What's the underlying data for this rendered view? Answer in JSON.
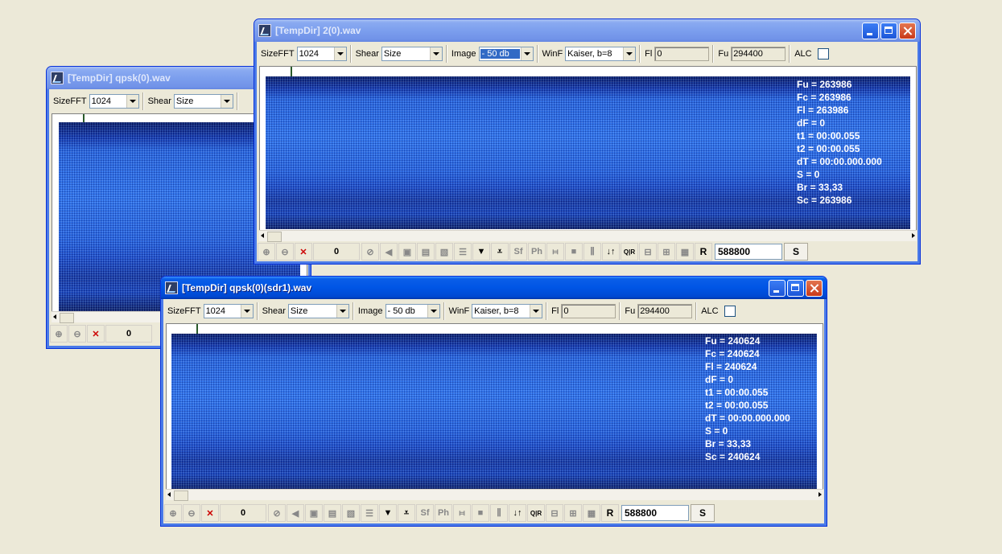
{
  "windows": {
    "back": {
      "title": "[TempDir] qpsk(0).wav",
      "sizefft_label": "SizeFFT",
      "sizefft_value": "1024",
      "shear_label": "Shear",
      "shear_value": "Size",
      "counter": "0"
    },
    "top": {
      "title": "[TempDir] 2(0).wav",
      "sizefft_label": "SizeFFT",
      "sizefft_value": "1024",
      "shear_label": "Shear",
      "shear_value": "Size",
      "image_label": "Image",
      "image_value": "- 50 db",
      "winf_label": "WinF",
      "winf_value": "Kaiser, b=8",
      "fl_label": "Fl",
      "fl_value": "0",
      "fu_label": "Fu",
      "fu_value": "294400",
      "alc_label": "ALC",
      "readout": [
        "Fu = 263986",
        "Fc = 263986",
        "Fl = 263986",
        "dF = 0",
        "t1 = 00:00.055",
        "t2 = 00:00.055",
        "dT = 00:00.000.000",
        "S = 0",
        "Br = 33,33",
        "Sc = 263986"
      ],
      "counter": "0",
      "rate_value": "588800",
      "r_label": "R",
      "s_label": "S"
    },
    "front": {
      "title": "[TempDir] qpsk(0)(sdr1).wav",
      "sizefft_label": "SizeFFT",
      "sizefft_value": "1024",
      "shear_label": "Shear",
      "shear_value": "Size",
      "image_label": "Image",
      "image_value": "- 50 db",
      "winf_label": "WinF",
      "winf_value": "Kaiser, b=8",
      "fl_label": "Fl",
      "fl_value": "0",
      "fu_label": "Fu",
      "fu_value": "294400",
      "alc_label": "ALC",
      "readout": [
        "Fu = 240624",
        "Fc = 240624",
        "Fl = 240624",
        "dF = 0",
        "t1 = 00:00.055",
        "t2 = 00:00.055",
        "dT = 00:00.000.000",
        "S = 0",
        "Br = 33,33",
        "Sc = 240624"
      ],
      "counter": "0",
      "rate_value": "588800",
      "r_label": "R",
      "s_label": "S"
    }
  },
  "toolbar_icons": {
    "sf": "Sf",
    "ph": "Ph",
    "qr": "Q|R"
  }
}
